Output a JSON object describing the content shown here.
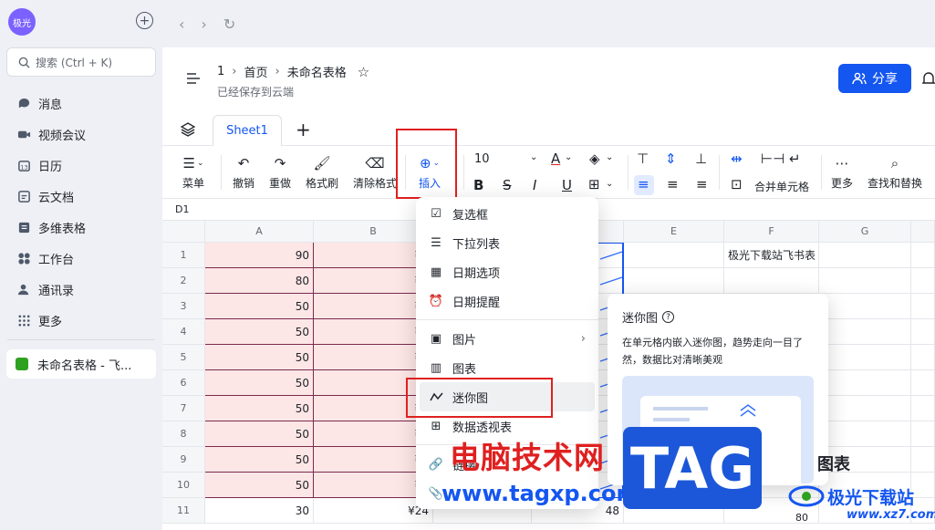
{
  "sidebar": {
    "avatar_text": "极光",
    "search_placeholder": "搜索 (Ctrl + K)",
    "items": [
      {
        "label": "消息",
        "icon": "message-icon"
      },
      {
        "label": "视频会议",
        "icon": "video-icon"
      },
      {
        "label": "日历",
        "icon": "calendar-icon"
      },
      {
        "label": "云文档",
        "icon": "cloud-doc-icon"
      },
      {
        "label": "多维表格",
        "icon": "base-icon"
      },
      {
        "label": "工作台",
        "icon": "workplace-icon"
      },
      {
        "label": "通讯录",
        "icon": "contacts-icon"
      },
      {
        "label": "更多",
        "icon": "more-icon"
      }
    ],
    "current_doc": "未命名表格 - 飞..."
  },
  "header": {
    "crumb_num": "1",
    "crumb_home": "首页",
    "crumb_title": "未命名表格",
    "saved_status": "已经保存到云端",
    "share_label": "分享"
  },
  "tabs": {
    "sheet1": "Sheet1"
  },
  "toolbar": {
    "menu": "菜单",
    "undo": "撤销",
    "redo": "重做",
    "format_painter": "格式刷",
    "clear_format": "清除格式",
    "insert": "插入",
    "font_size": "10",
    "merge": "合并单元格",
    "more": "更多",
    "find_replace": "查找和替换"
  },
  "cell_ref": "D1",
  "columns": [
    "A",
    "B",
    "C",
    "D",
    "E",
    "F",
    "G"
  ],
  "rows": [
    {
      "num": "1",
      "a": "90",
      "b": "¥9",
      "f": "极光下载站飞书表"
    },
    {
      "num": "2",
      "a": "80",
      "b": "¥7",
      "f": ""
    },
    {
      "num": "3",
      "a": "50",
      "b": "¥6",
      "f": ""
    },
    {
      "num": "4",
      "a": "50",
      "b": "¥6",
      "f": ""
    },
    {
      "num": "5",
      "a": "50",
      "b": "¥6",
      "f": ""
    },
    {
      "num": "6",
      "a": "50",
      "b": "¥",
      "f": ""
    },
    {
      "num": "7",
      "a": "50",
      "b": "¥7",
      "f": ""
    },
    {
      "num": "8",
      "a": "50",
      "b": "¥6",
      "f": ""
    },
    {
      "num": "9",
      "a": "50",
      "b": "¥6",
      "f": ""
    },
    {
      "num": "10",
      "a": "50",
      "b": "¥6",
      "f": ""
    },
    {
      "num": "11",
      "a": "30",
      "b": "¥24",
      "d": "48",
      "f": ""
    }
  ],
  "insert_menu": {
    "checkbox": "复选框",
    "dropdown_list": "下拉列表",
    "date_option": "日期选项",
    "date_reminder": "日期提醒",
    "image": "图片",
    "chart": "图表",
    "sparkline": "迷你图",
    "pivot_table": "数据透视表",
    "link": "链接"
  },
  "sparkline_tip": {
    "title": "迷你图",
    "description": "在单元格内嵌入迷你图，趋势走向一目了然，数据比对清晰美观"
  },
  "watermark": {
    "cn_text": "电脑技术网",
    "url": "www.tagxp.com",
    "logo": "TAG",
    "brand": "极光下载站",
    "brand_url": "www.xz7.com"
  },
  "behind_text": {
    "chart_word": "图表",
    "num80": "80"
  }
}
